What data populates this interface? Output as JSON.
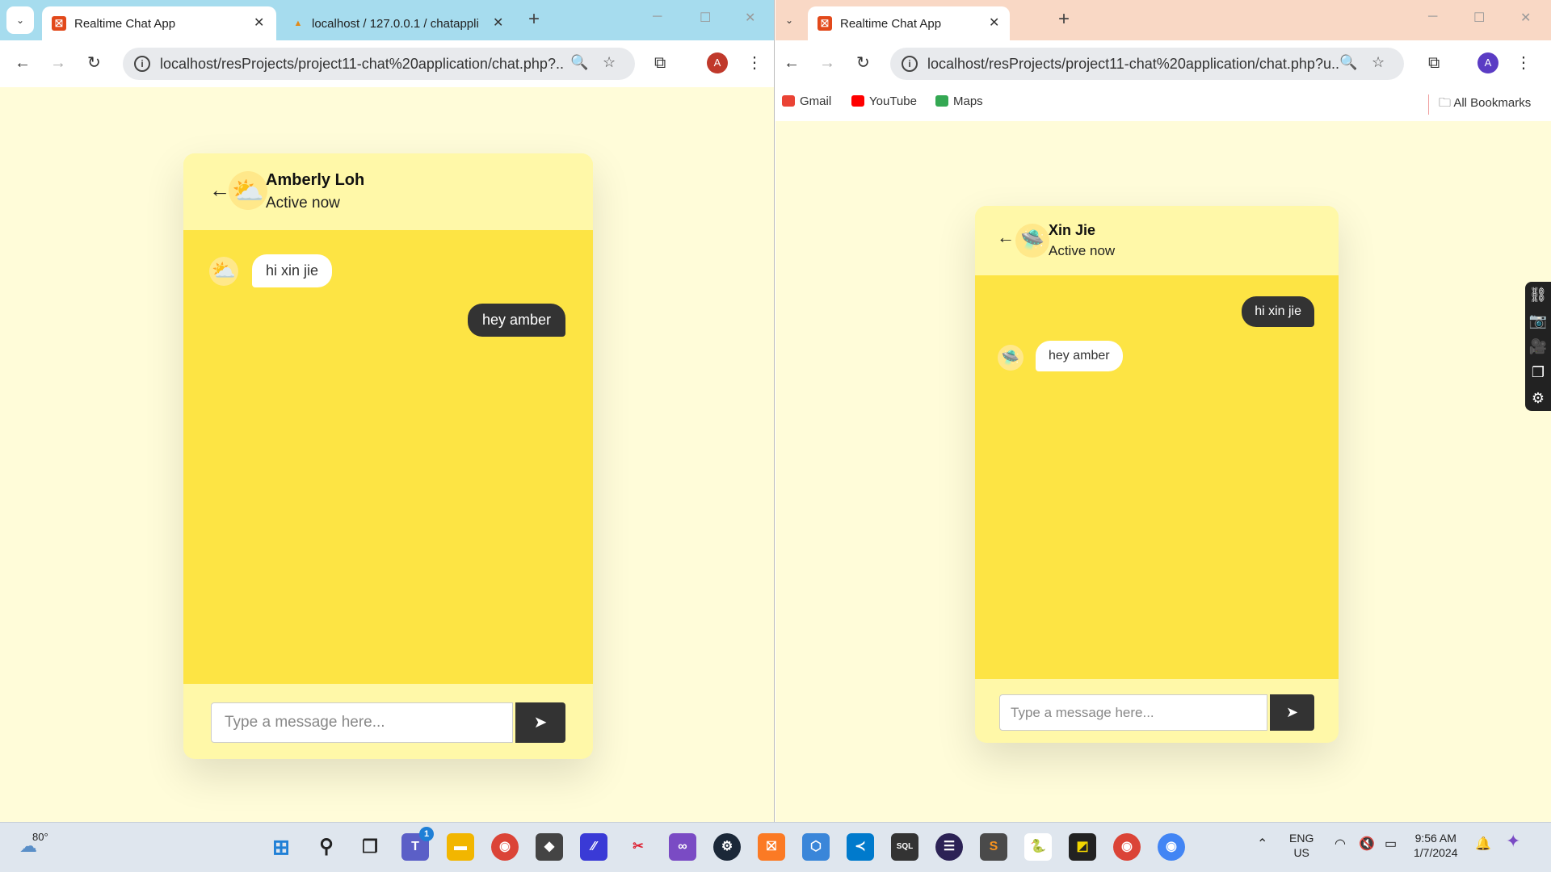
{
  "left_browser": {
    "tabs": [
      {
        "title": "Realtime Chat App"
      },
      {
        "title": "localhost / 127.0.0.1 / chatappli"
      }
    ],
    "url": "localhost/resProjects/project11-chat%20application/chat.php?...",
    "profile_initial": "A",
    "chat": {
      "name": "Amberly Loh",
      "status": "Active now",
      "messages": [
        {
          "direction": "in",
          "text": "hi xin jie"
        },
        {
          "direction": "out",
          "text": "hey amber"
        }
      ],
      "input_placeholder": "Type a message here..."
    }
  },
  "right_browser": {
    "tabs": [
      {
        "title": "Realtime Chat App"
      }
    ],
    "url": "localhost/resProjects/project11-chat%20application/chat.php?u...",
    "profile_initial": "A",
    "bookmarks": [
      {
        "label": "Gmail",
        "icon": "gmail-icon",
        "color": "#ea4335"
      },
      {
        "label": "YouTube",
        "icon": "youtube-icon",
        "color": "#ff0000"
      },
      {
        "label": "Maps",
        "icon": "maps-icon",
        "color": "#34a853"
      }
    ],
    "all_bookmarks": "All Bookmarks",
    "chat": {
      "name": "Xin Jie",
      "status": "Active now",
      "messages": [
        {
          "direction": "out",
          "text": "hi xin jie"
        },
        {
          "direction": "in",
          "text": "hey amber"
        }
      ],
      "input_placeholder": "Type a message here..."
    }
  },
  "taskbar": {
    "weather": "80°",
    "teams_badge": "1",
    "language": "ENG",
    "region": "US",
    "time": "9:56 AM",
    "date": "1/7/2024"
  },
  "colors": {
    "page_bg": "#fffcd9",
    "card_header": "#fff8a8",
    "chat_area": "#fde444",
    "outgoing_bubble": "#333333",
    "incoming_bubble": "#ffffff"
  }
}
